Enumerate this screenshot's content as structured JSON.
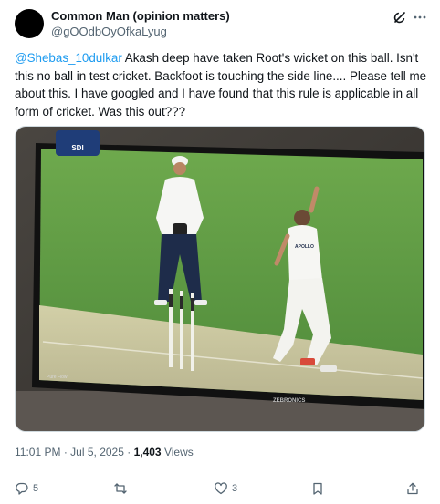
{
  "author": {
    "display_name": "Common Man (opinion matters)",
    "handle": "@gOOdbOyOfkaLyug"
  },
  "icons": {
    "grok": "grok-icon",
    "more": "more-icon",
    "reply": "reply-icon",
    "retweet": "retweet-icon",
    "like": "heart-icon",
    "bookmark": "bookmark-icon",
    "share": "share-icon"
  },
  "tweet": {
    "mention": "@Shebas_10dulkar",
    "text": " Akash deep have taken Root's wicket on this ball. Isn't this no ball in test cricket. Backfoot is touching the side line.... Please tell me about this. I have googled and I have found that this rule is applicable in all form of cricket. Was this out???"
  },
  "media": {
    "bowler_shirt_text": "APOLLO",
    "tv_corner_label": "Pure Flow",
    "tv_brand": "ZEBRONICS",
    "channel_logo": "SDI"
  },
  "meta": {
    "time": "11:01 PM",
    "date": "Jul 5, 2025",
    "separator": "·",
    "views_count": "1,403",
    "views_label": "Views"
  },
  "actions": {
    "reply_count": "5",
    "retweet_count": "",
    "like_count": "3"
  },
  "colors": {
    "link": "#1d9bf0",
    "text": "#0f1419",
    "secondary": "#536471",
    "pitch_green": "#62a046"
  }
}
